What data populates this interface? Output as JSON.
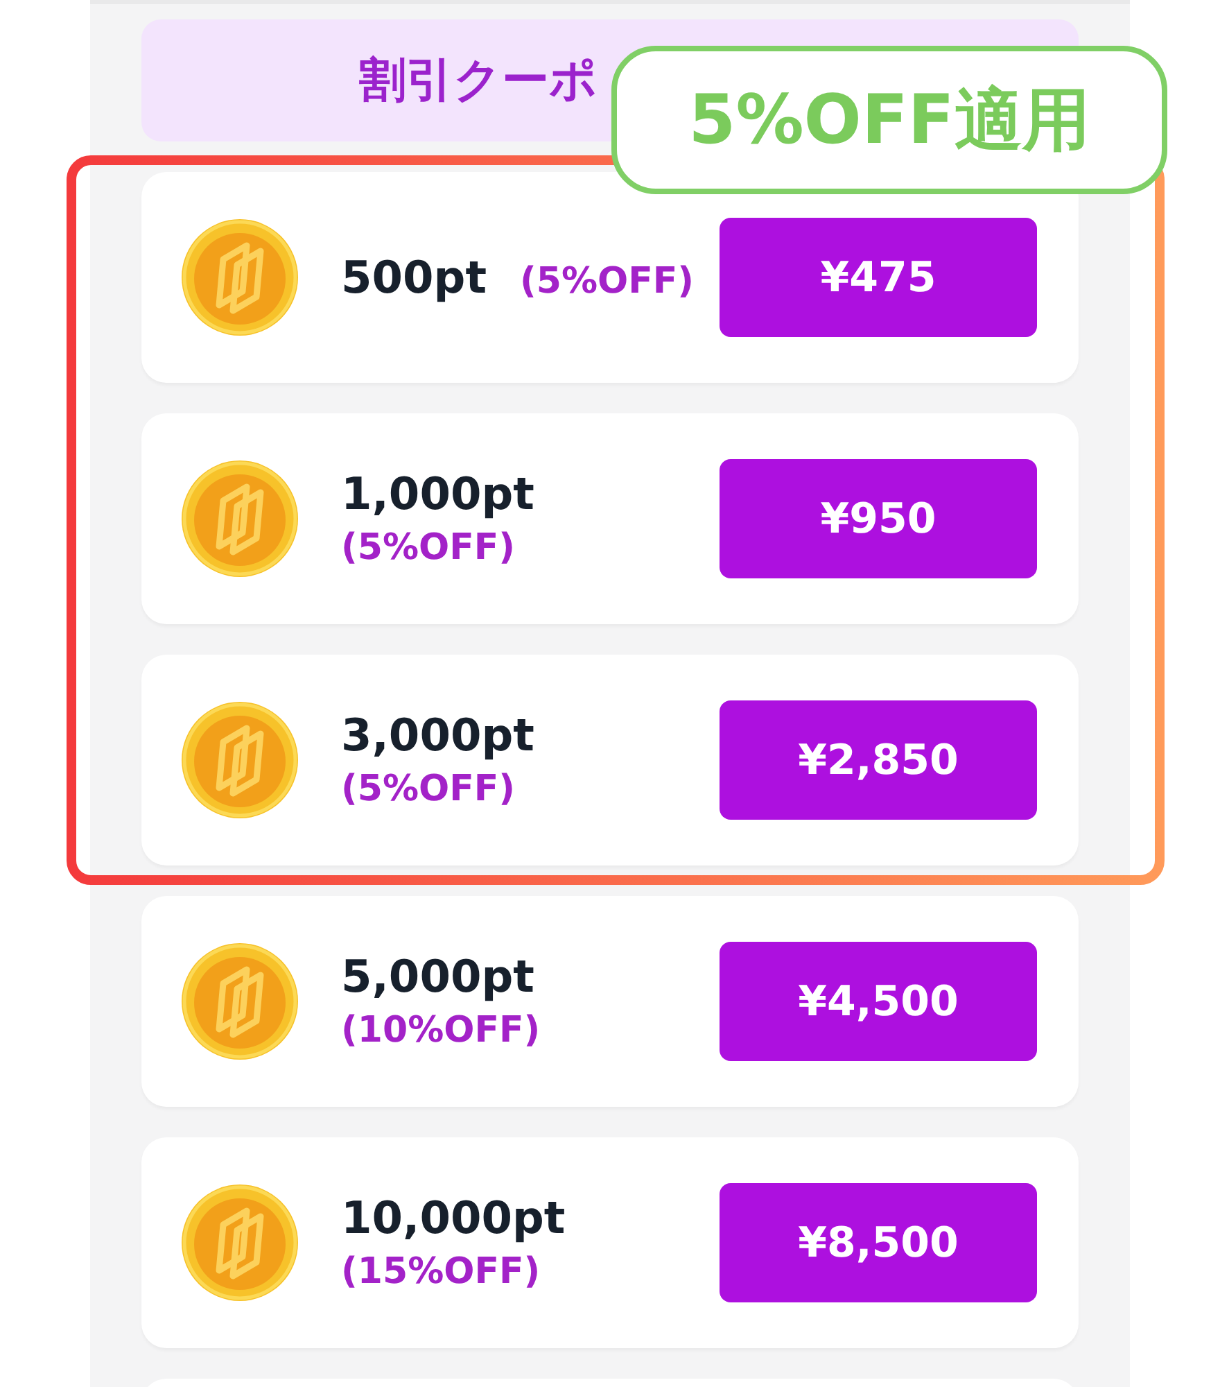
{
  "banner": {
    "text": "割引クーポ"
  },
  "callout": {
    "text": "5%OFF適用"
  },
  "highlighted_packages": [
    {
      "points": "500pt",
      "discount": "(5%OFF)",
      "price": "¥475"
    },
    {
      "points": "1,000pt",
      "discount": "(5%OFF)",
      "price": "¥950"
    },
    {
      "points": "3,000pt",
      "discount": "(5%OFF)",
      "price": "¥2,850"
    }
  ],
  "packages": [
    {
      "points": "5,000pt",
      "discount": "(10%OFF)",
      "price": "¥4,500"
    },
    {
      "points": "10,000pt",
      "discount": "(15%OFF)",
      "price": "¥8,500"
    }
  ]
}
